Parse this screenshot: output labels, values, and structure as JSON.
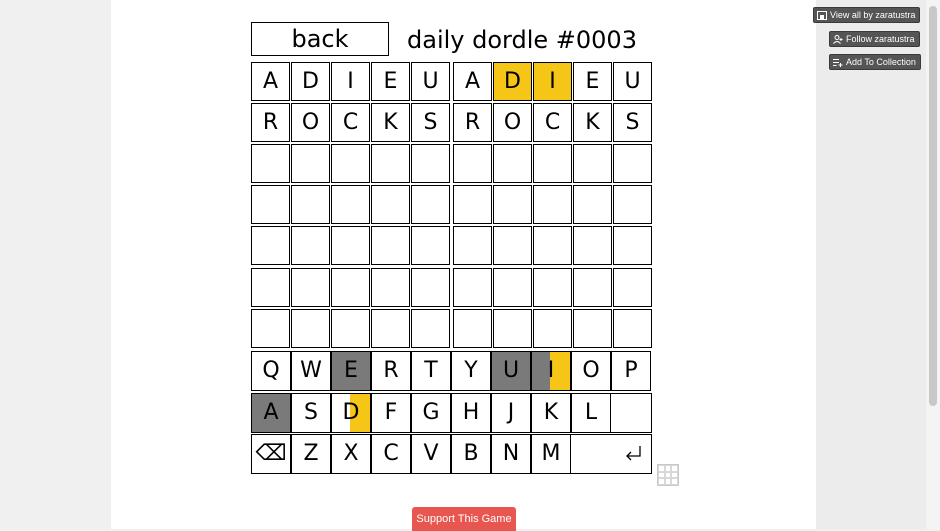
{
  "sidebar": {
    "view_all": "View all by zaratustra",
    "follow": "Follow zaratustra",
    "add_collection": "Add To Collection"
  },
  "game": {
    "back_label": "back",
    "title": "daily dordle #0003"
  },
  "boards": [
    {
      "rows": [
        [
          {
            "l": "A",
            "s": ""
          },
          {
            "l": "D",
            "s": ""
          },
          {
            "l": "I",
            "s": ""
          },
          {
            "l": "E",
            "s": ""
          },
          {
            "l": "U",
            "s": ""
          }
        ],
        [
          {
            "l": "R",
            "s": ""
          },
          {
            "l": "O",
            "s": ""
          },
          {
            "l": "C",
            "s": ""
          },
          {
            "l": "K",
            "s": ""
          },
          {
            "l": "S",
            "s": ""
          }
        ],
        [
          {
            "l": "",
            "s": ""
          },
          {
            "l": "",
            "s": ""
          },
          {
            "l": "",
            "s": ""
          },
          {
            "l": "",
            "s": ""
          },
          {
            "l": "",
            "s": ""
          }
        ],
        [
          {
            "l": "",
            "s": ""
          },
          {
            "l": "",
            "s": ""
          },
          {
            "l": "",
            "s": ""
          },
          {
            "l": "",
            "s": ""
          },
          {
            "l": "",
            "s": ""
          }
        ],
        [
          {
            "l": "",
            "s": ""
          },
          {
            "l": "",
            "s": ""
          },
          {
            "l": "",
            "s": ""
          },
          {
            "l": "",
            "s": ""
          },
          {
            "l": "",
            "s": ""
          }
        ],
        [
          {
            "l": "",
            "s": ""
          },
          {
            "l": "",
            "s": ""
          },
          {
            "l": "",
            "s": ""
          },
          {
            "l": "",
            "s": ""
          },
          {
            "l": "",
            "s": ""
          }
        ],
        [
          {
            "l": "",
            "s": ""
          },
          {
            "l": "",
            "s": ""
          },
          {
            "l": "",
            "s": ""
          },
          {
            "l": "",
            "s": ""
          },
          {
            "l": "",
            "s": ""
          }
        ]
      ]
    },
    {
      "rows": [
        [
          {
            "l": "A",
            "s": ""
          },
          {
            "l": "D",
            "s": "yellow"
          },
          {
            "l": "I",
            "s": "yellow"
          },
          {
            "l": "E",
            "s": ""
          },
          {
            "l": "U",
            "s": ""
          }
        ],
        [
          {
            "l": "R",
            "s": ""
          },
          {
            "l": "O",
            "s": ""
          },
          {
            "l": "C",
            "s": ""
          },
          {
            "l": "K",
            "s": ""
          },
          {
            "l": "S",
            "s": ""
          }
        ],
        [
          {
            "l": "",
            "s": ""
          },
          {
            "l": "",
            "s": ""
          },
          {
            "l": "",
            "s": ""
          },
          {
            "l": "",
            "s": ""
          },
          {
            "l": "",
            "s": ""
          }
        ],
        [
          {
            "l": "",
            "s": ""
          },
          {
            "l": "",
            "s": ""
          },
          {
            "l": "",
            "s": ""
          },
          {
            "l": "",
            "s": ""
          },
          {
            "l": "",
            "s": ""
          }
        ],
        [
          {
            "l": "",
            "s": ""
          },
          {
            "l": "",
            "s": ""
          },
          {
            "l": "",
            "s": ""
          },
          {
            "l": "",
            "s": ""
          },
          {
            "l": "",
            "s": ""
          }
        ],
        [
          {
            "l": "",
            "s": ""
          },
          {
            "l": "",
            "s": ""
          },
          {
            "l": "",
            "s": ""
          },
          {
            "l": "",
            "s": ""
          },
          {
            "l": "",
            "s": ""
          }
        ],
        [
          {
            "l": "",
            "s": ""
          },
          {
            "l": "",
            "s": ""
          },
          {
            "l": "",
            "s": ""
          },
          {
            "l": "",
            "s": ""
          },
          {
            "l": "",
            "s": ""
          }
        ]
      ]
    }
  ],
  "keyboard": {
    "row1": [
      {
        "l": "Q",
        "s": ""
      },
      {
        "l": "W",
        "s": ""
      },
      {
        "l": "E",
        "s": "absent"
      },
      {
        "l": "R",
        "s": ""
      },
      {
        "l": "T",
        "s": ""
      },
      {
        "l": "Y",
        "s": ""
      },
      {
        "l": "U",
        "s": "absent"
      },
      {
        "l": "I",
        "s": "absent half-right"
      },
      {
        "l": "O",
        "s": ""
      },
      {
        "l": "P",
        "s": ""
      }
    ],
    "row2": [
      {
        "l": "A",
        "s": "absent"
      },
      {
        "l": "S",
        "s": ""
      },
      {
        "l": "D",
        "s": "half-right"
      },
      {
        "l": "F",
        "s": ""
      },
      {
        "l": "G",
        "s": ""
      },
      {
        "l": "H",
        "s": ""
      },
      {
        "l": "J",
        "s": ""
      },
      {
        "l": "K",
        "s": ""
      },
      {
        "l": "L",
        "s": ""
      }
    ],
    "row3": [
      {
        "l": "⌫",
        "s": "",
        "name": "backspace-key"
      },
      {
        "l": "Z",
        "s": ""
      },
      {
        "l": "X",
        "s": ""
      },
      {
        "l": "C",
        "s": ""
      },
      {
        "l": "V",
        "s": ""
      },
      {
        "l": "B",
        "s": ""
      },
      {
        "l": "N",
        "s": ""
      },
      {
        "l": "M",
        "s": ""
      }
    ],
    "enter_icon": "enter-icon"
  },
  "colors": {
    "present": "#f5c518",
    "absent": "#7a7a7a",
    "support": "#e8574f"
  },
  "support_label": "Support This Game"
}
